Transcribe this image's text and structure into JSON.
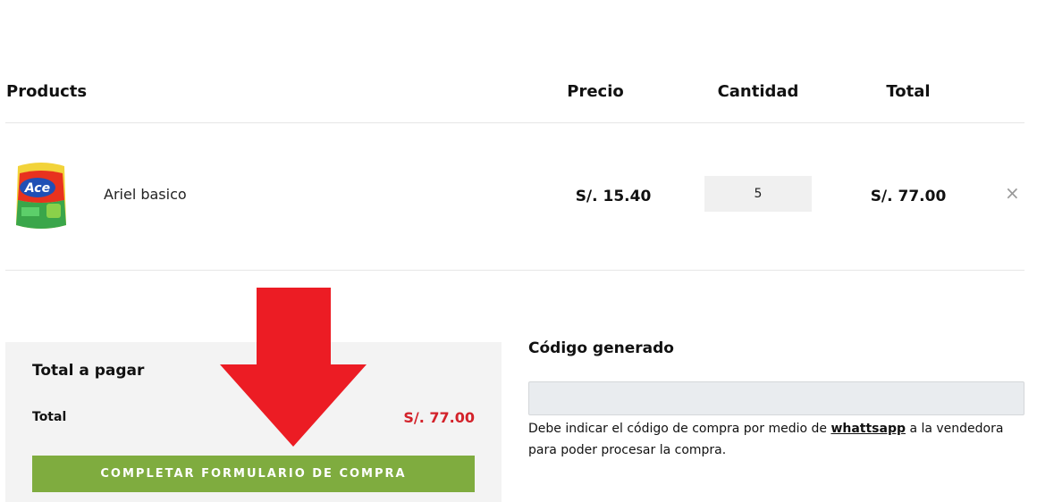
{
  "table": {
    "headers": {
      "products": "Products",
      "precio": "Precio",
      "cantidad": "Cantidad",
      "total": "Total"
    },
    "items": [
      {
        "name": "Ariel basico",
        "price": "S/. 15.40",
        "quantity": "5",
        "line_total": "S/. 77.00",
        "image_icon": "detergent-package-icon"
      }
    ],
    "remove_symbol": "×"
  },
  "totals": {
    "title": "Total a pagar",
    "label": "Total",
    "value": "S/. 77.00",
    "button_label": "COMPLETAR FORMULARIO DE COMPRA"
  },
  "code": {
    "title": "Código generado",
    "value": "",
    "note_before": "Debe indicar el código de compra por medio de ",
    "note_link": "whattsapp",
    "note_after": " a la vendedora para poder procesar la compra."
  },
  "colors": {
    "button": "#7fac3f",
    "total_value": "#d3222a",
    "arrow": "#ec1c24",
    "totals_bg": "#f3f3f3"
  }
}
